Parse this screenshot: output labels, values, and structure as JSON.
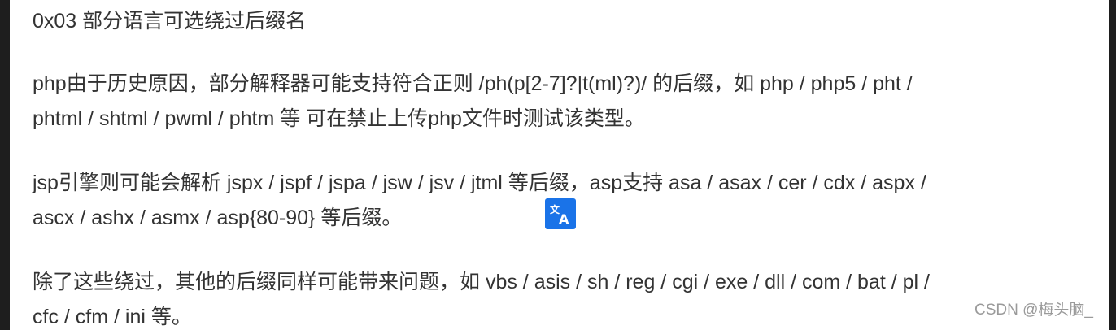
{
  "article": {
    "heading": "0x03 部分语言可选绕过后缀名",
    "paragraphs": [
      {
        "line1": "php由于历史原因，部分解释器可能支持符合正则 /ph(p[2-7]?|t(ml)?)/ 的后缀，如 php / php5 / pht /",
        "line2": "phtml / shtml / pwml / phtm 等 可在禁止上传php文件时测试该类型。"
      },
      {
        "line1": "jsp引擎则可能会解析 jspx / jspf / jspa / jsw / jsv / jtml 等后缀，asp支持 asa / asax / cer / cdx / aspx /",
        "line2": "ascx / ashx / asmx / asp{80-90} 等后缀。"
      },
      {
        "line1": "除了这些绕过，其他的后缀同样可能带来问题，如 vbs / asis / sh / reg / cgi / exe / dll / com / bat / pl /",
        "line2": "cfc / cfm / ini 等。"
      }
    ]
  },
  "overlay": {
    "translate_icon": "translate-icon",
    "translate_icon_color": "#1a73e8"
  },
  "watermark": {
    "text": "CSDN @梅头脑_"
  },
  "colors": {
    "text": "#333333",
    "background": "#ffffff",
    "frame": "#1e1e1e",
    "watermark": "#9a9a9a"
  }
}
